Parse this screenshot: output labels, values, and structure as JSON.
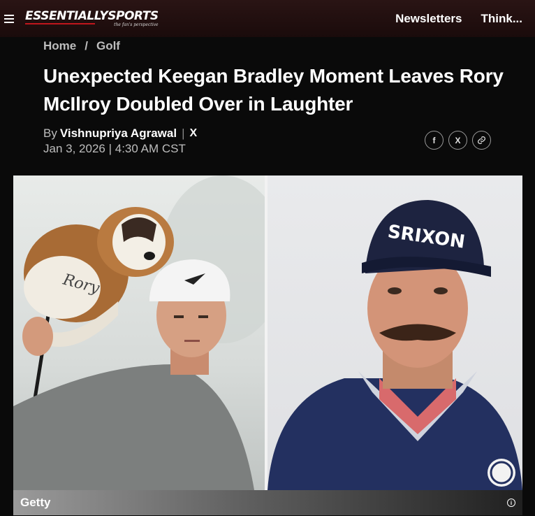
{
  "header": {
    "logo_text": "ESSENTIALLYSPORTS",
    "logo_tagline": "the fan's perspective",
    "nav": [
      "Newsletters",
      "Think..."
    ]
  },
  "breadcrumb": {
    "home": "Home",
    "separator": "/",
    "section": "Golf"
  },
  "article": {
    "headline": "Unexpected Keegan Bradley Moment Leaves Rory McIlroy Doubled Over in Laughter",
    "by_prefix": "By",
    "author": "Vishnupriya Agrawal",
    "byline_separator": "|",
    "x_icon": "X",
    "date": "Jan 3, 2026",
    "date_separator": "|",
    "time": "4:30 AM CST"
  },
  "share": {
    "icons": [
      "facebook-icon",
      "x-icon",
      "link-icon"
    ],
    "labels": [
      "f",
      "X",
      "🔗"
    ]
  },
  "hero": {
    "caption": "Getty",
    "info_icon": "i",
    "left_cap_brand": "",
    "right_cap_brand": "SRIXON",
    "headcover_text": "Rory"
  },
  "colors": {
    "topbar": "#1f0e0e",
    "accent": "#c0161d",
    "background": "#0a0a0a"
  }
}
